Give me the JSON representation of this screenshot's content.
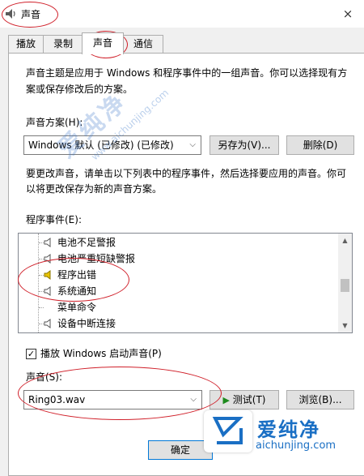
{
  "window": {
    "title": "声音",
    "close": "×"
  },
  "tabs": [
    "播放",
    "录制",
    "声音",
    "通信"
  ],
  "description": [
    "声音主题是应用于 Windows 和程序事件中的一组声音。你可以选择现有方",
    "案或保存修改后的方案。"
  ],
  "scheme": {
    "label": "声音方案(H):",
    "value": "Windows 默认 (已修改) (已修改)",
    "save_as": "另存为(V)...",
    "delete": "删除(D)"
  },
  "instructions": [
    "要更改声音，请单击以下列表中的程序事件，然后选择要应用的声音。你可",
    "以将更改保存为新的声音方案。"
  ],
  "events": {
    "label": "程序事件(E):",
    "items": [
      {
        "label": "电池不足警报",
        "has_sound": true
      },
      {
        "label": "电池严重短缺警报",
        "has_sound": true
      },
      {
        "label": "程序出错",
        "has_sound": true
      },
      {
        "label": "系统通知",
        "has_sound": true
      },
      {
        "label": "菜单命令",
        "has_sound": false
      },
      {
        "label": "设备中断连接",
        "has_sound": true
      }
    ],
    "selected_index": 2
  },
  "startup_sound": {
    "label": "播放 Windows 启动声音(P)",
    "checked": true
  },
  "sound": {
    "label": "声音(S):",
    "value": "Ring03.wav",
    "test": "测试(T)",
    "browse": "浏览(B)..."
  },
  "footer": {
    "ok": "确定"
  },
  "watermark": {
    "name": "爱纯净",
    "url": "aichunjing.com",
    "diagonal": "爱纯净",
    "diagonal_url": "www.aichunjing.com"
  },
  "colors": {
    "annotation": "#d0202a",
    "brand": "#1a6fc4",
    "speaker_active": "#e8c400"
  }
}
